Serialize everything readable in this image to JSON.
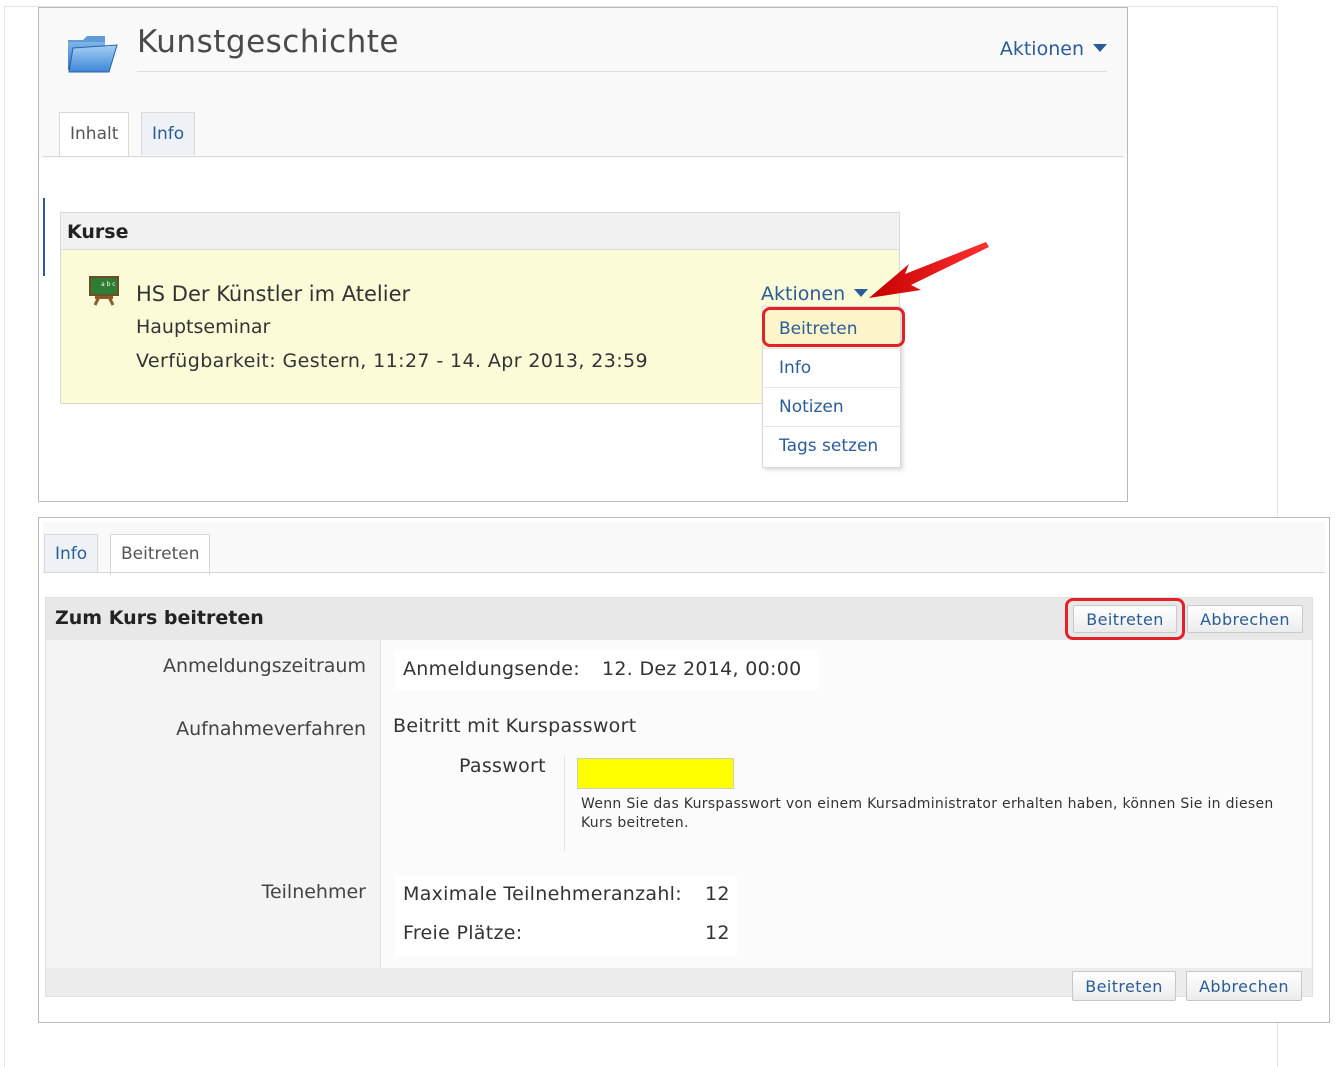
{
  "panel1": {
    "title": "Kunstgeschichte",
    "actions_label": "Aktionen",
    "tabs": [
      {
        "label": "Inhalt",
        "active": true
      },
      {
        "label": "Info",
        "active": false
      }
    ],
    "section_title": "Kurse",
    "course": {
      "name": "HS Der Künstler im Atelier",
      "type": "Hauptseminar",
      "availability": "Verfügbarkeit: Gestern, 11:27 - 14. Apr 2013, 23:59",
      "actions_label": "Aktionen",
      "menu": [
        "Beitreten",
        "Info",
        "Notizen",
        "Tags setzen"
      ]
    }
  },
  "panel2": {
    "tabs": [
      {
        "label": "Info",
        "active": false
      },
      {
        "label": "Beitreten",
        "active": true
      }
    ],
    "form_title": "Zum Kurs beitreten",
    "buttons": {
      "join": "Beitreten",
      "cancel": "Abbrechen"
    },
    "rows": {
      "registration_label": "Anmeldungszeitraum",
      "registration_end_label": "Anmeldungsende:",
      "registration_end_value": "12. Dez 2014, 00:00",
      "procedure_label": "Aufnahmeverfahren",
      "procedure_value": "Beitritt mit Kurspasswort",
      "password_label": "Passwort",
      "password_value": "",
      "password_hint": "Wenn Sie das Kurspasswort von einem Kursadministrator erhalten haben, können Sie in diesen Kurs beitreten.",
      "participants_label": "Teilnehmer",
      "max_label": "Maximale Teilnehmeranzahl:",
      "max_value": "12",
      "free_label": "Freie Plätze:",
      "free_value": "12"
    }
  },
  "colors": {
    "link": "#2a5c99",
    "highlight_ring": "#e2222b",
    "course_background": "#fcfbd8",
    "password_field": "#ffff00"
  },
  "icons": {
    "title_icon": "folder-icon",
    "course_icon": "chalkboard-easel-icon",
    "pointer": "red-arrow-icon"
  }
}
